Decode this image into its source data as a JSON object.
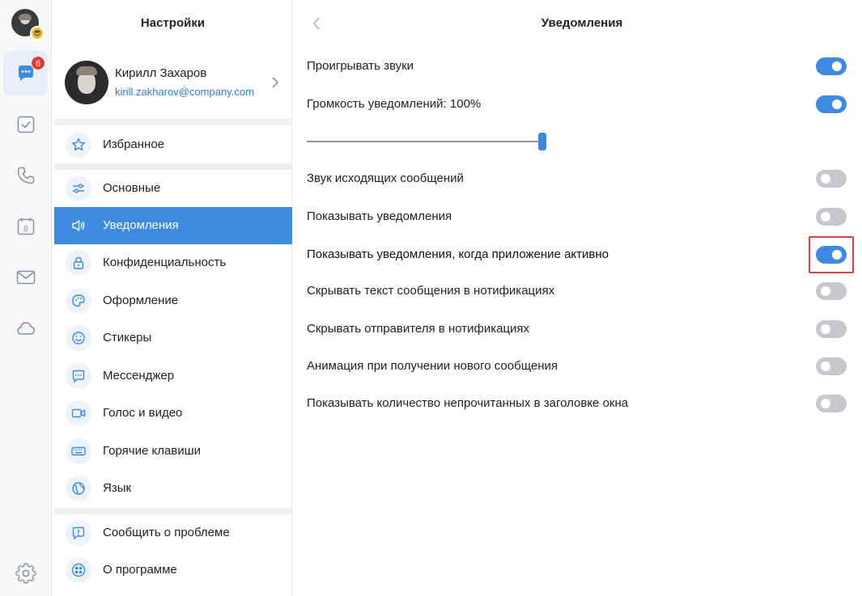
{
  "colors": {
    "accent": "#3d8ae0",
    "badge": "#e53935",
    "focus": "#e0413d"
  },
  "rail": {
    "avatar_emoji": "😎",
    "chat_badge": "6",
    "icons": [
      "chat-icon",
      "tasks-icon",
      "phone-icon",
      "calendar-icon",
      "mail-icon",
      "cloud-icon",
      "settings-gear-icon"
    ],
    "calendar_day": "8"
  },
  "settings": {
    "title": "Настройки",
    "profile": {
      "name": "Кирилл Захаров",
      "email": "kirill.zakharov@company.com"
    },
    "groups": [
      [
        {
          "label": "Избранное",
          "icon": "star-icon"
        }
      ],
      [
        {
          "label": "Основные",
          "icon": "sliders-icon"
        },
        {
          "label": "Уведомления",
          "icon": "speaker-icon",
          "active": true
        },
        {
          "label": "Конфиденциальность",
          "icon": "lock-icon"
        },
        {
          "label": "Оформление",
          "icon": "palette-icon"
        },
        {
          "label": "Стикеры",
          "icon": "smile-icon"
        },
        {
          "label": "Мессенджер",
          "icon": "message-icon"
        },
        {
          "label": "Голос и видео",
          "icon": "video-icon"
        },
        {
          "label": "Горячие клавиши",
          "icon": "keyboard-icon"
        },
        {
          "label": "Язык",
          "icon": "globe-icon"
        }
      ],
      [
        {
          "label": "Сообщить о проблеме",
          "icon": "report-icon"
        },
        {
          "label": "О программе",
          "icon": "about-icon"
        }
      ]
    ]
  },
  "notifications": {
    "title": "Уведомления",
    "volume_percent": 100,
    "rows": [
      {
        "label": "Проигрывать звуки",
        "on": true
      },
      {
        "label": "Громкость уведомлений: 100%",
        "on": true
      },
      {
        "label": "Звук исходящих сообщений",
        "on": false
      },
      {
        "label": "Показывать уведомления",
        "on": false
      },
      {
        "label": "Показывать уведомления, когда приложение активно",
        "on": true,
        "highlighted": true
      },
      {
        "label": "Скрывать текст сообщения в нотификациях",
        "on": false
      },
      {
        "label": "Скрывать отправителя в нотификациях",
        "on": false
      },
      {
        "label": "Анимация при получении нового сообщения",
        "on": false
      },
      {
        "label": "Показывать количество непрочитанных в заголовке окна",
        "on": false
      }
    ]
  }
}
